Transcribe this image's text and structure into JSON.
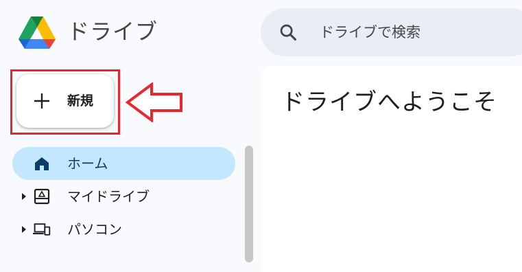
{
  "app": {
    "title": "ドライブ"
  },
  "search": {
    "placeholder": "ドライブで検索"
  },
  "new_button": {
    "label": "新規"
  },
  "sidebar": {
    "items": [
      {
        "label": "ホーム",
        "icon": "home-icon",
        "active": true
      },
      {
        "label": "マイドライブ",
        "icon": "my-drive-icon",
        "expandable": true
      },
      {
        "label": "パソコン",
        "icon": "computers-icon",
        "expandable": true
      }
    ]
  },
  "main": {
    "heading": "ドライブへようこそ"
  },
  "colors": {
    "background": "#f8fafd",
    "search_bg": "#e9eef6",
    "active_nav_bg": "#c2e7ff",
    "annotation_red": "#e8262c"
  }
}
